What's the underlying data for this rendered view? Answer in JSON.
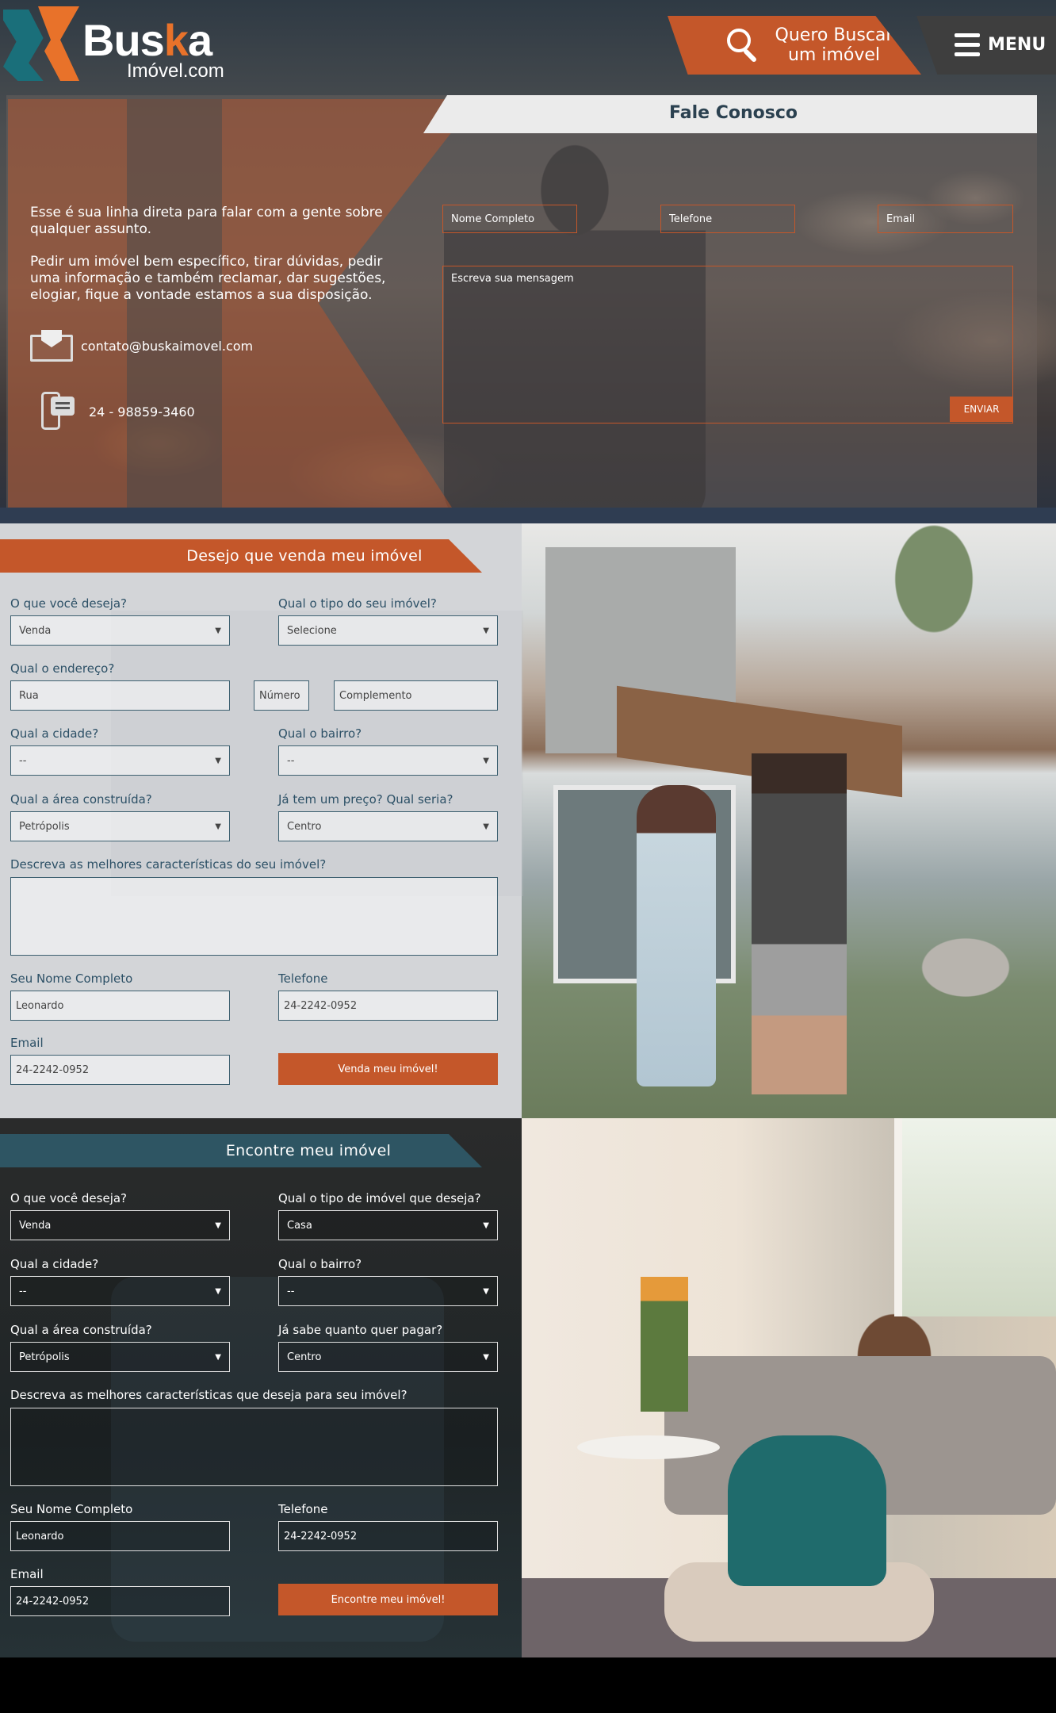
{
  "brand": {
    "name_part1": "Bus",
    "name_k": "k",
    "name_part2": "a",
    "domain": "Imóvel.com"
  },
  "header": {
    "search_label": "Quero Buscar um imóvel",
    "menu_label": "MENU"
  },
  "contact": {
    "title": "Fale Conosco",
    "intro_1": "Esse é sua linha direta para falar com a gente sobre qualquer assunto.",
    "intro_2": "Pedir um imóvel bem específico, tirar dúvidas, pedir uma informação e também reclamar, dar sugestões, elogiar, fique a vontade estamos a sua disposição.",
    "email": "contato@buskaimovel.com",
    "phone": "24 - 98859-3460",
    "name_placeholder": "Nome Completo",
    "phone_placeholder": "Telefone",
    "email_placeholder": "Email",
    "message_placeholder": "Escreva sua mensagem",
    "send_label": "ENVIAR"
  },
  "sell": {
    "title": "Desejo que venda meu imóvel",
    "want_label": "O que você deseja?",
    "want_value": "Venda",
    "type_label": "Qual o tipo do seu imóvel?",
    "type_value": "Selecione",
    "address_label": "Qual o endereço?",
    "street_placeholder": "Rua",
    "number_placeholder": "Número",
    "complement_placeholder": "Complemento",
    "city_label": "Qual a cidade?",
    "city_value": "--",
    "district_label": "Qual o bairro?",
    "district_value": "--",
    "area_label": "Qual a área construída?",
    "area_value": "Petrópolis",
    "price_label": "Já tem um preço? Qual seria?",
    "price_value": "Centro",
    "desc_label": "Descreva as melhores características do seu imóvel?",
    "name_label": "Seu Nome Completo",
    "name_value": "Leonardo",
    "phone_label": "Telefone",
    "phone_value": "24-2242-0952",
    "email_label": "Email",
    "email_value": "24-2242-0952",
    "submit_label": "Venda meu imóvel!"
  },
  "find": {
    "title": "Encontre meu imóvel",
    "want_label": "O que você deseja?",
    "want_value": "Venda",
    "type_label": "Qual o tipo de imóvel que deseja?",
    "type_value": "Casa",
    "city_label": "Qual a cidade?",
    "city_value": "--",
    "district_label": "Qual o bairro?",
    "district_value": "--",
    "area_label": "Qual a área construída?",
    "area_value": "Petrópolis",
    "price_label": "Já sabe quanto quer pagar?",
    "price_value": "Centro",
    "desc_label": "Descreva as melhores características que deseja para seu imóvel?",
    "name_label": "Seu Nome Completo",
    "name_value": "Leonardo",
    "phone_label": "Telefone",
    "phone_value": "24-2242-0952",
    "email_label": "Email",
    "email_value": "24-2242-0952",
    "submit_label": "Encontre meu imóvel!"
  },
  "colors": {
    "accent": "#c4572a",
    "teal": "#2e5563",
    "dark": "#3e3e3e"
  },
  "icons": [
    "search-icon",
    "menu-icon",
    "envelope-icon",
    "phone-chat-icon",
    "chevron-down-icon"
  ]
}
